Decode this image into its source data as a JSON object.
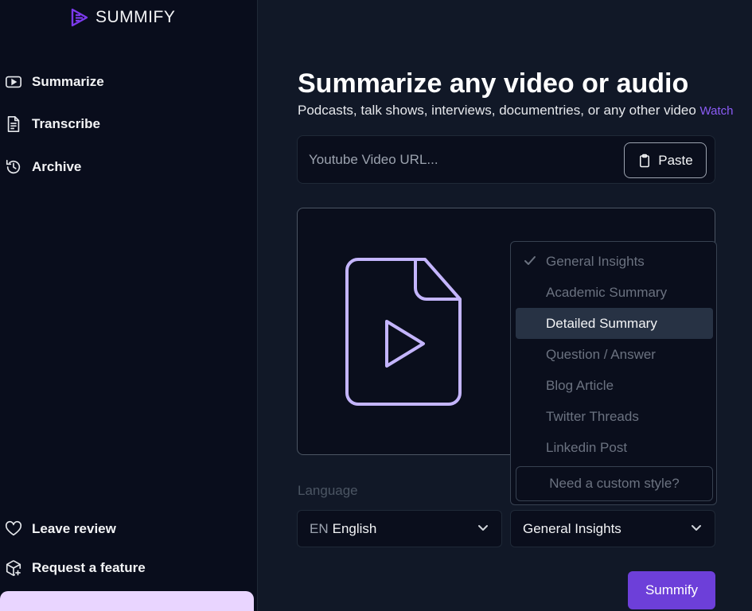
{
  "brand": {
    "name": "SUMMIFY",
    "accent": "#7c3aed"
  },
  "sidebar": {
    "nav": [
      {
        "label": "Summarize",
        "icon": "video-icon"
      },
      {
        "label": "Transcribe",
        "icon": "document-icon"
      },
      {
        "label": "Archive",
        "icon": "history-icon"
      }
    ],
    "footer": [
      {
        "label": "Leave review",
        "icon": "heart-icon"
      },
      {
        "label": "Request a feature",
        "icon": "package-plus-icon"
      }
    ]
  },
  "main": {
    "title": "Summarize any video or audio",
    "subtitle": "Podcasts, talk shows, interviews, documentries, or any other video",
    "watch_link": "Watch",
    "url_input": {
      "placeholder": "Youtube Video URL...",
      "value": ""
    },
    "paste_label": "Paste"
  },
  "style_dropdown": {
    "options": [
      {
        "label": "General Insights",
        "checked": true,
        "highlighted": false
      },
      {
        "label": "Academic Summary",
        "checked": false,
        "highlighted": false
      },
      {
        "label": "Detailed Summary",
        "checked": false,
        "highlighted": true
      },
      {
        "label": "Question / Answer",
        "checked": false,
        "highlighted": false
      },
      {
        "label": "Blog Article",
        "checked": false,
        "highlighted": false
      },
      {
        "label": "Twitter Threads",
        "checked": false,
        "highlighted": false
      },
      {
        "label": "Linkedin Post",
        "checked": false,
        "highlighted": false
      }
    ],
    "custom_label": "Need a custom style?"
  },
  "language": {
    "label": "Language",
    "code": "EN",
    "selected": "English"
  },
  "style_select": {
    "selected": "General Insights"
  },
  "submit_label": "Summify"
}
